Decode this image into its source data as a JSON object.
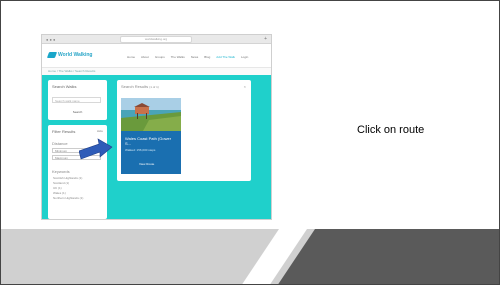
{
  "instruction": "Click on route",
  "screenshot": {
    "browser": {
      "window_controls": "● ● ●",
      "url": "worldwalking.org",
      "plus": "+"
    },
    "header": {
      "logo_text": "World Walking",
      "nav": [
        "Home",
        "About",
        "Groups",
        "The Walks",
        "News",
        "Blog",
        "Add The Walk",
        "Login"
      ],
      "nav_highlight_index": 6
    },
    "breadcrumb": "Home  /  The Walks  /  Search Results",
    "search": {
      "title": "Search Walks",
      "placeholder": "Search walk name",
      "button_label": "Search"
    },
    "filter": {
      "title": "Filter Results",
      "hide_label": "Hide",
      "distance_label": "Distance",
      "distance_values": [
        "Minimum",
        "Maximum"
      ],
      "keywords_label": "Keywords",
      "keywords": [
        "Scottish Highlands (1)",
        "Scotland (1)",
        "UK (1)",
        "Wales (1)",
        "Northern Highlands (1)"
      ]
    },
    "results": {
      "title": "Search Results",
      "count": "(1 of 1)",
      "close": "×",
      "card": {
        "title": "Wales Coast Path (Gower S...",
        "subtitle": "Walked: 156,000 steps",
        "button_label": "View Route"
      }
    }
  },
  "colors": {
    "teal_background": "#1fd0cb",
    "card_blue": "#1a6fb0",
    "arrow_blue": "#2f5cb8",
    "footer_light": "#d0d0d0",
    "footer_dark": "#5a5a5a"
  }
}
